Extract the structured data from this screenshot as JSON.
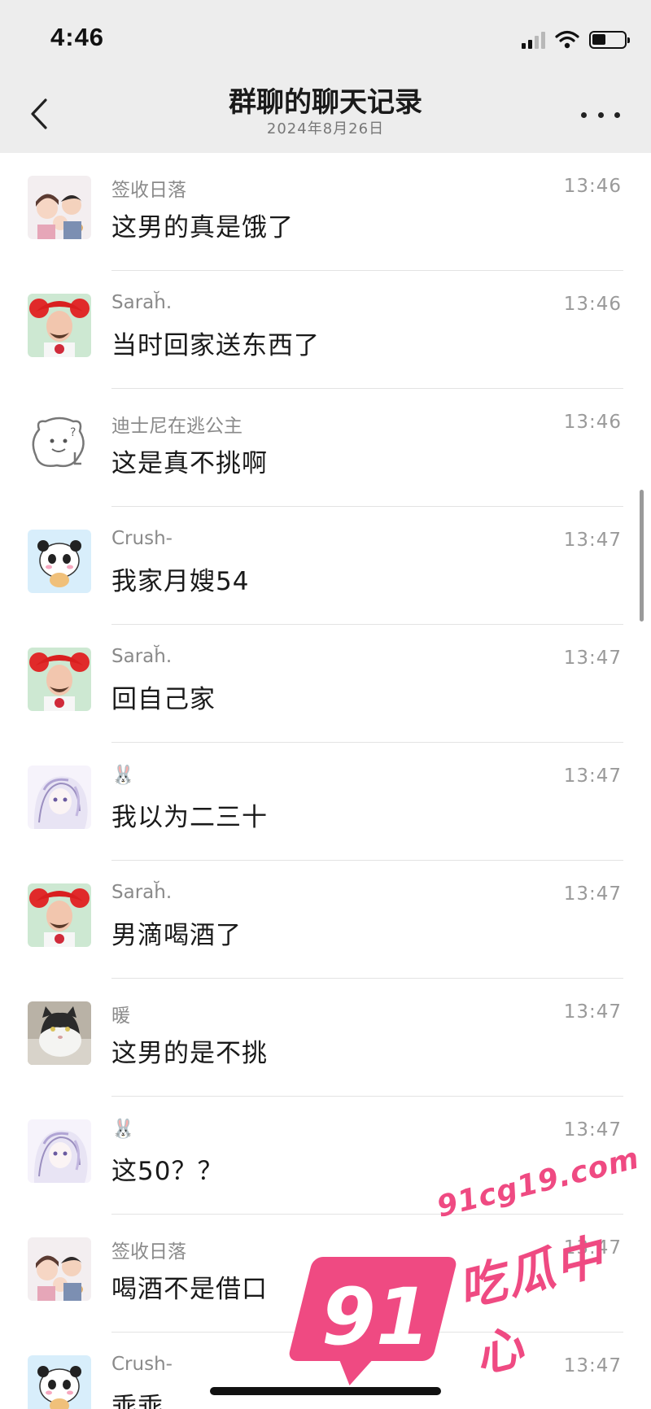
{
  "status_bar": {
    "time": "4:46"
  },
  "header": {
    "title": "群聊的聊天记录",
    "subtitle": "2024年8月26日"
  },
  "messages": [
    {
      "sender": "签收日落",
      "time": "13:46",
      "text": "这男的真是饿了",
      "avatar": "family-cartoon-avatar"
    },
    {
      "sender": "Sarah̆.",
      "time": "13:46",
      "text": "当时回家送东西了",
      "avatar": "red-hair-cartoon-avatar"
    },
    {
      "sender": "迪士尼在逃公主",
      "time": "13:46",
      "text": "这是真不挑啊",
      "avatar": "sketch-bear-avatar"
    },
    {
      "sender": "Crush-",
      "time": "13:47",
      "text": "我家月嫂54",
      "avatar": "panda-cartoon-avatar"
    },
    {
      "sender": "Sarah̆.",
      "time": "13:47",
      "text": "回自己家",
      "avatar": "red-hair-cartoon-avatar"
    },
    {
      "sender": "🐰",
      "time": "13:47",
      "text": "我以为二三十",
      "avatar": "anime-girl-avatar"
    },
    {
      "sender": "Sarah̆.",
      "time": "13:47",
      "text": "男滴喝酒了",
      "avatar": "red-hair-cartoon-avatar"
    },
    {
      "sender": "暖",
      "time": "13:47",
      "text": "这男的是不挑",
      "avatar": "cat-photo-avatar"
    },
    {
      "sender": "🐰",
      "time": "13:47",
      "text": "这50？？",
      "avatar": "anime-girl-avatar"
    },
    {
      "sender": "签收日落",
      "time": "13:47",
      "text": "喝酒不是借口",
      "avatar": "family-cartoon-avatar"
    },
    {
      "sender": "Crush-",
      "time": "13:47",
      "text": "乖乖",
      "avatar": "panda-cartoon-avatar"
    }
  ],
  "watermark": {
    "number": "91",
    "url": "91cg19.com",
    "name": "吃瓜中心"
  },
  "colors": {
    "header_bg": "#ededed",
    "watermark_pink": "#ef4a82",
    "separator": "#e3e3e3"
  }
}
